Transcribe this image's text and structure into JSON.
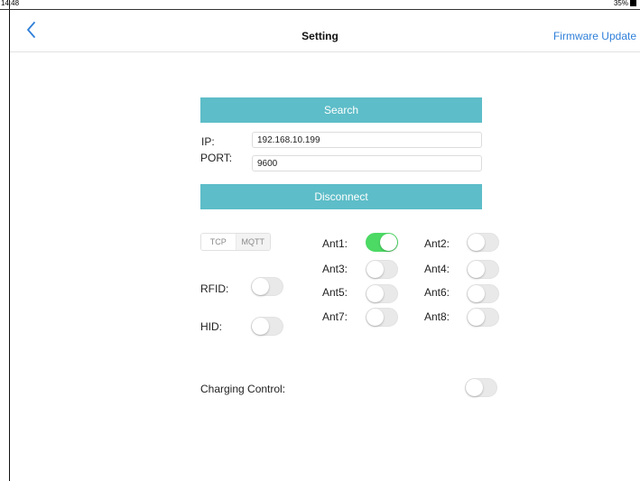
{
  "status": {
    "time": "14:48",
    "battery": "35%"
  },
  "nav": {
    "title": "Setting",
    "right_label": "Firmware Update"
  },
  "search_label": "Search",
  "ip": {
    "label": "IP:",
    "value": "192.168.10.199"
  },
  "port": {
    "label": "PORT:",
    "value": "9600"
  },
  "disconnect_label": "Disconnect",
  "protocol": {
    "options": [
      "TCP",
      "MQTT"
    ],
    "selected": "TCP"
  },
  "rfid": {
    "label": "RFID:",
    "on": false
  },
  "hid": {
    "label": "HID:",
    "on": false
  },
  "antennas": [
    {
      "label": "Ant1:",
      "on": true
    },
    {
      "label": "Ant2:",
      "on": false
    },
    {
      "label": "Ant3:",
      "on": false
    },
    {
      "label": "Ant4:",
      "on": false
    },
    {
      "label": "Ant5:",
      "on": false
    },
    {
      "label": "Ant6:",
      "on": false
    },
    {
      "label": "Ant7:",
      "on": false
    },
    {
      "label": "Ant8:",
      "on": false
    }
  ],
  "charging": {
    "label": "Charging Control:",
    "on": false
  },
  "colors": {
    "accent": "#5dbdc8",
    "link": "#2f7fd9",
    "toggle_on": "#4cd964",
    "toggle_off": "#e9e9ea"
  }
}
